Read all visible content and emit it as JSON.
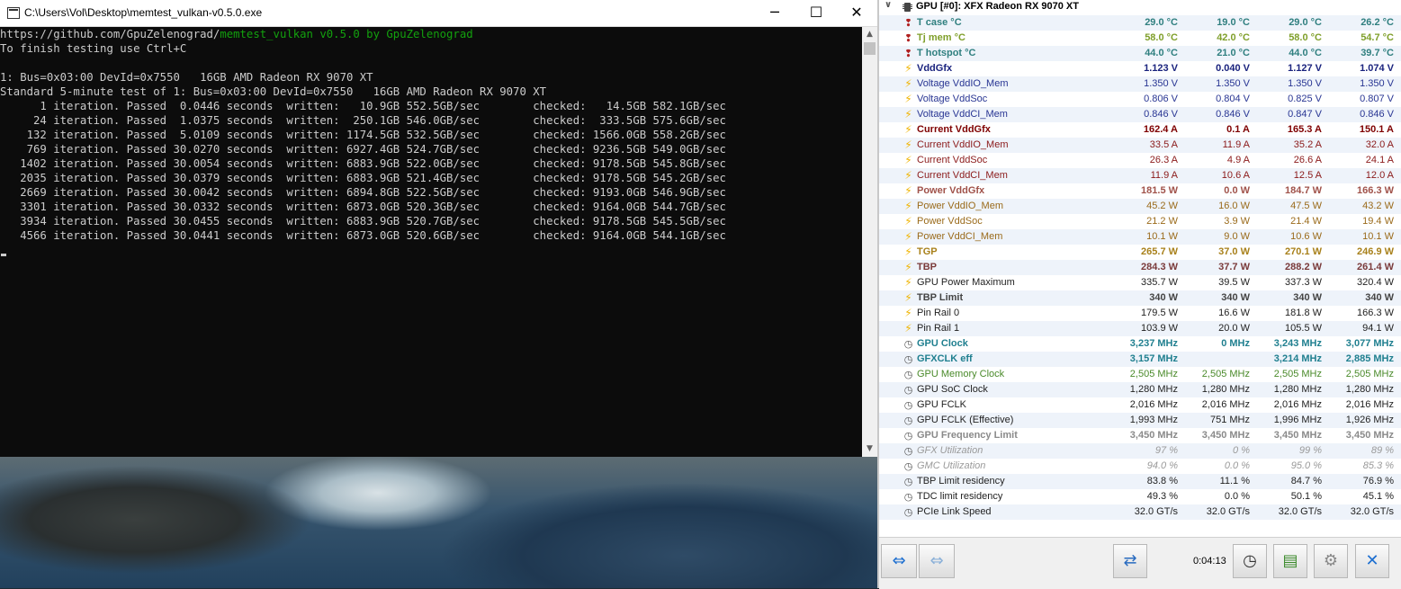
{
  "console": {
    "title": "C:\\Users\\Vol\\Desktop\\memtest_vulkan-v0.5.0.exe",
    "url": "https://github.com/GpuZelenograd/",
    "app": "memtest_vulkan v0.5.0 by GpuZelenograd",
    "lines": [
      "To finish testing use Ctrl+C",
      "",
      "1: Bus=0x03:00 DevId=0x7550   16GB AMD Radeon RX 9070 XT",
      "Standard 5-minute test of 1: Bus=0x03:00 DevId=0x7550   16GB AMD Radeon RX 9070 XT",
      "      1 iteration. Passed  0.0446 seconds  written:   10.9GB 552.5GB/sec        checked:   14.5GB 582.1GB/sec",
      "     24 iteration. Passed  1.0375 seconds  written:  250.1GB 546.0GB/sec        checked:  333.5GB 575.6GB/sec",
      "    132 iteration. Passed  5.0109 seconds  written: 1174.5GB 532.5GB/sec        checked: 1566.0GB 558.2GB/sec",
      "    769 iteration. Passed 30.0270 seconds  written: 6927.4GB 524.7GB/sec        checked: 9236.5GB 549.0GB/sec",
      "   1402 iteration. Passed 30.0054 seconds  written: 6883.9GB 522.0GB/sec        checked: 9178.5GB 545.8GB/sec",
      "   2035 iteration. Passed 30.0379 seconds  written: 6883.9GB 521.4GB/sec        checked: 9178.5GB 545.2GB/sec",
      "   2669 iteration. Passed 30.0042 seconds  written: 6894.8GB 522.5GB/sec        checked: 9193.0GB 546.9GB/sec",
      "   3301 iteration. Passed 30.0332 seconds  written: 6873.0GB 520.3GB/sec        checked: 9164.0GB 544.7GB/sec",
      "   3934 iteration. Passed 30.0455 seconds  written: 6883.9GB 520.7GB/sec        checked: 9178.5GB 545.5GB/sec",
      "   4566 iteration. Passed 30.0441 seconds  written: 6873.0GB 520.6GB/sec        checked: 9164.0GB 544.1GB/sec"
    ]
  },
  "hwinfo": {
    "group": "GPU [#0]: XFX Radeon RX 9070 XT",
    "sensors": [
      {
        "icon": "thermometer",
        "label": "T case °C",
        "vals": [
          "29.0 °C",
          "19.0 °C",
          "29.0 °C",
          "26.2 °C"
        ],
        "color": "#2f7f7f",
        "bold": true
      },
      {
        "icon": "thermometer",
        "label": "Tj mem °C",
        "vals": [
          "58.0 °C",
          "42.0 °C",
          "58.0 °C",
          "54.7 °C"
        ],
        "color": "#7f9f2a",
        "bold": true
      },
      {
        "icon": "thermometer",
        "label": "T hotspot °C",
        "vals": [
          "44.0 °C",
          "21.0 °C",
          "44.0 °C",
          "39.7 °C"
        ],
        "color": "#2f7f7f",
        "bold": true
      },
      {
        "icon": "bolt",
        "label": "VddGfx",
        "vals": [
          "1.123 V",
          "0.040 V",
          "1.127 V",
          "1.074 V"
        ],
        "color": "#1a237e",
        "bold": true
      },
      {
        "icon": "bolt",
        "label": "Voltage VddIO_Mem",
        "vals": [
          "1.350 V",
          "1.350 V",
          "1.350 V",
          "1.350 V"
        ],
        "color": "#283593",
        "bold": false
      },
      {
        "icon": "bolt",
        "label": "Voltage VddSoc",
        "vals": [
          "0.806 V",
          "0.804 V",
          "0.825 V",
          "0.807 V"
        ],
        "color": "#283593",
        "bold": false
      },
      {
        "icon": "bolt",
        "label": "Voltage VddCI_Mem",
        "vals": [
          "0.846 V",
          "0.846 V",
          "0.847 V",
          "0.846 V"
        ],
        "color": "#283593",
        "bold": false
      },
      {
        "icon": "bolt",
        "label": "Current VddGfx",
        "vals": [
          "162.4 A",
          "0.1 A",
          "165.3 A",
          "150.1 A"
        ],
        "color": "#7f0000",
        "bold": true
      },
      {
        "icon": "bolt",
        "label": "Current VddIO_Mem",
        "vals": [
          "33.5 A",
          "11.9 A",
          "35.2 A",
          "32.0 A"
        ],
        "color": "#8b1a1a",
        "bold": false
      },
      {
        "icon": "bolt",
        "label": "Current VddSoc",
        "vals": [
          "26.3 A",
          "4.9 A",
          "26.6 A",
          "24.1 A"
        ],
        "color": "#8b1a1a",
        "bold": false
      },
      {
        "icon": "bolt",
        "label": "Current VddCI_Mem",
        "vals": [
          "11.9 A",
          "10.6 A",
          "12.5 A",
          "12.0 A"
        ],
        "color": "#8b1a1a",
        "bold": false
      },
      {
        "icon": "bolt",
        "label": "Power VddGfx",
        "vals": [
          "181.5 W",
          "0.0 W",
          "184.7 W",
          "166.3 W"
        ],
        "color": "#a0524a",
        "bold": true
      },
      {
        "icon": "bolt",
        "label": "Power VddIO_Mem",
        "vals": [
          "45.2 W",
          "16.0 W",
          "47.5 W",
          "43.2 W"
        ],
        "color": "#9a6a1a",
        "bold": false
      },
      {
        "icon": "bolt",
        "label": "Power VddSoc",
        "vals": [
          "21.2 W",
          "3.9 W",
          "21.4 W",
          "19.4 W"
        ],
        "color": "#9a6a1a",
        "bold": false
      },
      {
        "icon": "bolt",
        "label": "Power VddCI_Mem",
        "vals": [
          "10.1 W",
          "9.0 W",
          "10.6 W",
          "10.1 W"
        ],
        "color": "#9a6a1a",
        "bold": false
      },
      {
        "icon": "bolt",
        "label": "TGP",
        "vals": [
          "265.7 W",
          "37.0 W",
          "270.1 W",
          "246.9 W"
        ],
        "color": "#a8801a",
        "bold": true
      },
      {
        "icon": "bolt",
        "label": "TBP",
        "vals": [
          "284.3 W",
          "37.7 W",
          "288.2 W",
          "261.4 W"
        ],
        "color": "#7a3a3a",
        "bold": true
      },
      {
        "icon": "bolt",
        "label": "GPU Power Maximum",
        "vals": [
          "335.7 W",
          "39.5 W",
          "337.3 W",
          "320.4 W"
        ],
        "color": "#222222",
        "bold": false
      },
      {
        "icon": "bolt",
        "label": "TBP Limit",
        "vals": [
          "340 W",
          "340 W",
          "340 W",
          "340 W"
        ],
        "color": "#444444",
        "bold": true
      },
      {
        "icon": "bolt",
        "label": "Pin Rail 0",
        "vals": [
          "179.5 W",
          "16.6 W",
          "181.8 W",
          "166.3 W"
        ],
        "color": "#222222",
        "bold": false
      },
      {
        "icon": "bolt",
        "label": "Pin Rail 1",
        "vals": [
          "103.9 W",
          "20.0 W",
          "105.5 W",
          "94.1 W"
        ],
        "color": "#222222",
        "bold": false
      },
      {
        "icon": "clock",
        "label": "GPU Clock",
        "vals": [
          "3,237 MHz",
          "0 MHz",
          "3,243 MHz",
          "3,077 MHz"
        ],
        "color": "#1f7f8f",
        "bold": true
      },
      {
        "icon": "clock",
        "label": "GFXCLK eff",
        "vals": [
          "3,157 MHz",
          "3,214 MHz",
          "2,885 MHz"
        ],
        "color": "#1f7f8f",
        "bold": true,
        "skip2": true
      },
      {
        "icon": "clock",
        "label": "GPU Memory Clock",
        "vals": [
          "2,505 MHz",
          "2,505 MHz",
          "2,505 MHz",
          "2,505 MHz"
        ],
        "color": "#4a8a2a",
        "bold": false
      },
      {
        "icon": "clock",
        "label": "GPU SoC Clock",
        "vals": [
          "1,280 MHz",
          "1,280 MHz",
          "1,280 MHz",
          "1,280 MHz"
        ],
        "color": "#222222",
        "bold": false
      },
      {
        "icon": "clock",
        "label": "GPU FCLK",
        "vals": [
          "2,016 MHz",
          "2,016 MHz",
          "2,016 MHz",
          "2,016 MHz"
        ],
        "color": "#222222",
        "bold": false
      },
      {
        "icon": "clock",
        "label": "GPU FCLK (Effective)",
        "vals": [
          "1,993 MHz",
          "751 MHz",
          "1,996 MHz",
          "1,926 MHz"
        ],
        "color": "#222222",
        "bold": false
      },
      {
        "icon": "clock",
        "label": "GPU Frequency Limit",
        "vals": [
          "3,450 MHz",
          "3,450 MHz",
          "3,450 MHz",
          "3,450 MHz"
        ],
        "color": "#8a8a8a",
        "bold": true
      },
      {
        "icon": "clock",
        "label": "GFX Utilization",
        "vals": [
          "97 %",
          "0 %",
          "99 %",
          "89 %"
        ],
        "color": "#9a9a9a",
        "bold": false,
        "italic": true
      },
      {
        "icon": "clock",
        "label": "GMC Utilization",
        "vals": [
          "94.0 %",
          "0.0 %",
          "95.0 %",
          "85.3 %"
        ],
        "color": "#9a9a9a",
        "bold": false,
        "italic": true
      },
      {
        "icon": "clock",
        "label": "TBP Limit residency",
        "vals": [
          "83.8 %",
          "11.1 %",
          "84.7 %",
          "76.9 %"
        ],
        "color": "#222222",
        "bold": false
      },
      {
        "icon": "clock",
        "label": "TDC limit residency",
        "vals": [
          "49.3 %",
          "0.0 %",
          "50.1 %",
          "45.1 %"
        ],
        "color": "#222222",
        "bold": false
      },
      {
        "icon": "clock",
        "label": "PCIe Link Speed",
        "vals": [
          "32.0 GT/s",
          "32.0 GT/s",
          "32.0 GT/s",
          "32.0 GT/s"
        ],
        "color": "#222222",
        "bold": false
      }
    ],
    "timer": "0:04:13"
  }
}
